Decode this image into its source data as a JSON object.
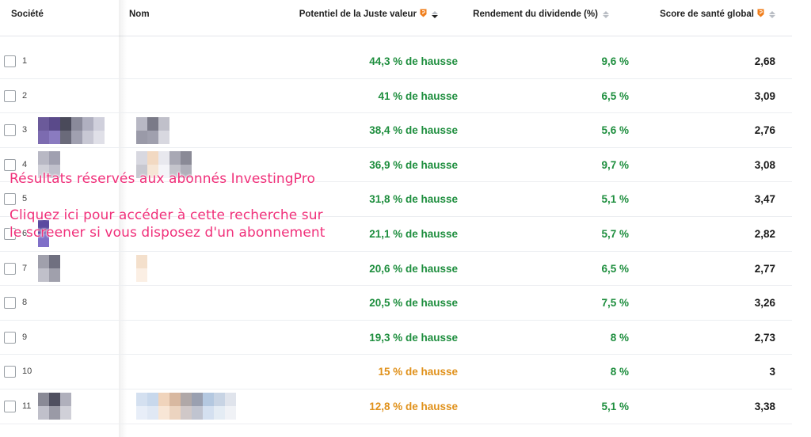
{
  "columns": {
    "societe": "Société",
    "nom": "Nom",
    "fair_value": "Potentiel de la Juste valeur",
    "dividend_yield": "Rendement du dividende (%)",
    "health_score": "Score de santé global"
  },
  "rows": [
    {
      "rank": "1",
      "fair_value": "44,3 % de hausse",
      "fv_color": "green",
      "dividend_yield": "9,6 %",
      "health_score": "2,68"
    },
    {
      "rank": "2",
      "fair_value": "41 % de hausse",
      "fv_color": "green",
      "dividend_yield": "6,5 %",
      "health_score": "3,09"
    },
    {
      "rank": "3",
      "fair_value": "38,4 % de hausse",
      "fv_color": "green",
      "dividend_yield": "5,6 %",
      "health_score": "2,76"
    },
    {
      "rank": "4",
      "fair_value": "36,9 % de hausse",
      "fv_color": "green",
      "dividend_yield": "9,7 %",
      "health_score": "3,08"
    },
    {
      "rank": "5",
      "fair_value": "31,8 % de hausse",
      "fv_color": "green",
      "dividend_yield": "5,1 %",
      "health_score": "3,47"
    },
    {
      "rank": "6",
      "fair_value": "21,1 % de hausse",
      "fv_color": "green",
      "dividend_yield": "5,7 %",
      "health_score": "2,82"
    },
    {
      "rank": "7",
      "fair_value": "20,6 % de hausse",
      "fv_color": "green",
      "dividend_yield": "6,5 %",
      "health_score": "2,77"
    },
    {
      "rank": "8",
      "fair_value": "20,5 % de hausse",
      "fv_color": "green",
      "dividend_yield": "7,5 %",
      "health_score": "3,26"
    },
    {
      "rank": "9",
      "fair_value": "19,3 % de hausse",
      "fv_color": "green",
      "dividend_yield": "8 %",
      "health_score": "2,73"
    },
    {
      "rank": "10",
      "fair_value": "15 % de hausse",
      "fv_color": "orange",
      "dividend_yield": "8 %",
      "health_score": "3"
    },
    {
      "rank": "11",
      "fair_value": "12,8 % de hausse",
      "fv_color": "orange",
      "dividend_yield": "5,1 %",
      "health_score": "3,38"
    }
  ],
  "overlay": {
    "line1": "Résultats réservés aux abonnés InvestingPro",
    "line2": "Cliquez ici pour accéder à cette recherche sur",
    "line3": "le screener si vous disposez d'un abonnement"
  },
  "colors": {
    "green": "#1e8e3e",
    "orange": "#e0911b",
    "overlay_pink": "#f0307a",
    "pro_icon": "#f07d1a"
  },
  "icons": {
    "pro": "investingpro-icon",
    "sort": "sort-icon",
    "checkbox": "checkbox-icon"
  }
}
